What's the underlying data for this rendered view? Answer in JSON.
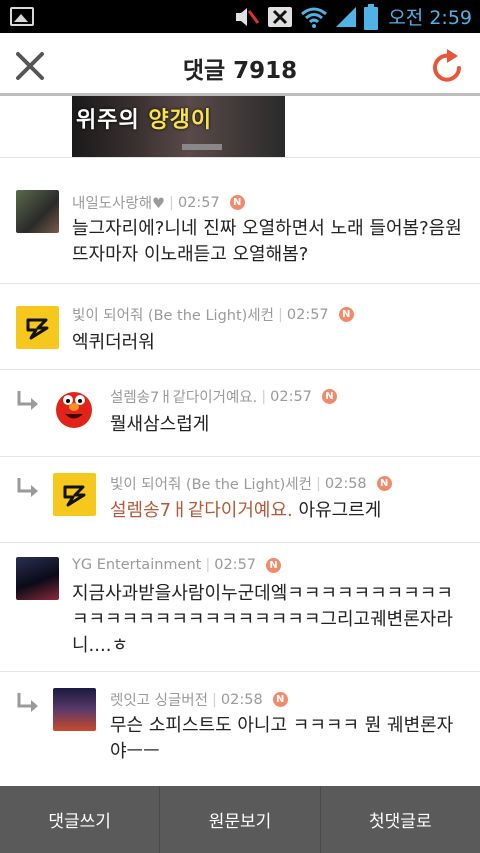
{
  "status_bar": {
    "time": "오전 2:59",
    "icons": [
      "gallery-icon",
      "mute-icon",
      "no-sim-icon",
      "wifi-icon",
      "signal-icon",
      "battery-icon"
    ]
  },
  "header": {
    "title": "댓글 7918",
    "close_icon": "close-icon",
    "refresh_icon": "refresh-icon",
    "accent_color": "#e8553a"
  },
  "top_thumbnail": {
    "caption_left": "위주의 ",
    "caption_right": "양갱이"
  },
  "comments": [
    {
      "author": "내일도사랑해♥",
      "time": "02:57",
      "badge": "N",
      "text": "늘그자리에?니네 진짜 오열하면서 노래 들어봄?음원뜨자마자 이노래듣고 오열해봄?",
      "reply": false
    },
    {
      "author": "빛이 되어줘 (Be the Light)세컨",
      "time": "02:57",
      "badge": "N",
      "text": "엑퀴더러워",
      "reply": false
    },
    {
      "author": "설렘송7ㅐ같다이거예요.",
      "time": "02:57",
      "badge": "N",
      "text": "뭘새삼스럽게",
      "reply": true
    },
    {
      "author": "빛이 되어줘 (Be the Light)세컨",
      "time": "02:58",
      "badge": "N",
      "mention": "설렘송7ㅐ같다이거예요.",
      "text": " 아유그르게",
      "reply": true
    },
    {
      "author": "YG Entertainment",
      "time": "02:57",
      "badge": "N",
      "text": "지금사과받을사람이누군데엨ㅋㅋㅋㅋㅋㅋㅋㅋㅋㅋㅋㅋㅋㅋㅋㅋㅋㅋㅋㅋㅋㅋㅋㅋㅋ그리고궤변론자라니....ㅎ",
      "reply": false
    },
    {
      "author": "렛잇고 싱글버전",
      "time": "02:58",
      "badge": "N",
      "text": "무슨 소피스트도 아니고 ㅋㅋㅋㅋ 뭔 궤변론자야ㅡㅡ",
      "reply": true
    }
  ],
  "bottom_bar": {
    "write_comment": "댓글쓰기",
    "view_original": "원문보기",
    "first_comment": "첫댓글로"
  }
}
